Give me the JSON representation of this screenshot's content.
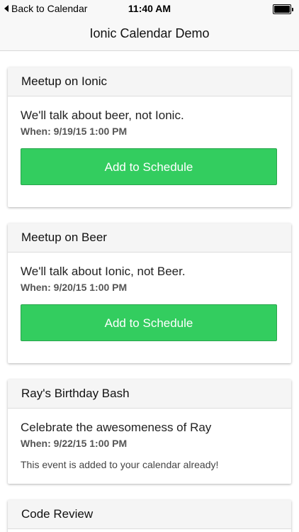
{
  "status_bar": {
    "back_label": "Back to Calendar",
    "time": "11:40 AM"
  },
  "nav": {
    "title": "Ionic Calendar Demo"
  },
  "events": [
    {
      "title": "Meetup on Ionic",
      "description": "We'll talk about beer, not Ionic.",
      "when": "When: 9/19/15 1:00 PM",
      "button_label": "Add to Schedule"
    },
    {
      "title": "Meetup on Beer",
      "description": "We'll talk about Ionic, not Beer.",
      "when": "When: 9/20/15 1:00 PM",
      "button_label": "Add to Schedule"
    },
    {
      "title": "Ray's Birthday Bash",
      "description": "Celebrate the awesomeness of Ray",
      "when": "When: 9/22/15 1:00 PM",
      "note": "This event is added to your calendar already!"
    },
    {
      "title": "Code Review"
    }
  ],
  "colors": {
    "button_green": "#33cd5f",
    "header_bg": "#f5f5f5",
    "bar_bg": "#f8f8f8"
  },
  "icons": {
    "back": "back-arrow-icon",
    "battery": "battery-icon"
  }
}
